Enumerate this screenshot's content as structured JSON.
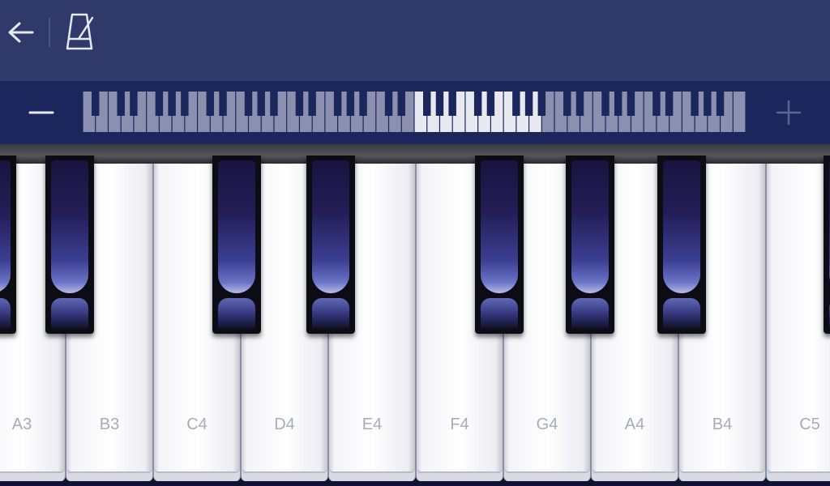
{
  "topbar": {
    "back_icon": "arrow-left-icon",
    "metronome_icon": "metronome-icon",
    "background_color": "#2f3a6a"
  },
  "zoom": {
    "minus_icon": "minus-icon",
    "plus_icon": "plus-icon",
    "accent_color": "#e8e8f0"
  },
  "keys": {
    "white": [
      "A3",
      "B3",
      "C4",
      "D4",
      "E4",
      "F4",
      "G4",
      "A4",
      "B4",
      "C5"
    ]
  },
  "colors": {
    "black_key": "#0c0d14",
    "label": "#a9abba"
  }
}
